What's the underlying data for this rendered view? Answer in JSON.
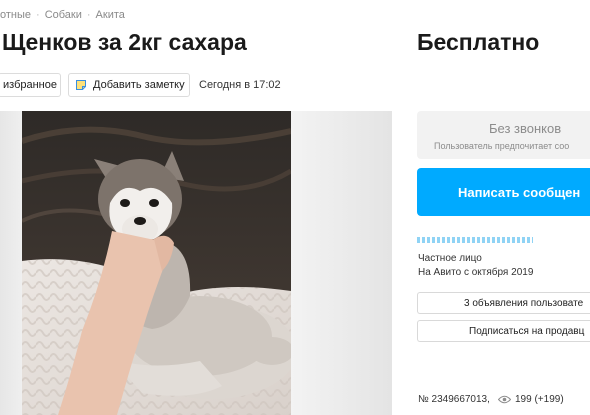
{
  "breadcrumb": [
    "отные",
    "Собаки",
    "Акита"
  ],
  "listing": {
    "title": "Щенков за 2кг сахара",
    "price": "Бесплатно",
    "date": "Сегодня в 17:02"
  },
  "actions": {
    "favorite_label": "избранное",
    "note_label": "Добавить заметку"
  },
  "contact": {
    "no_calls_title": "Без звонков",
    "no_calls_subtitle": "Пользователь предпочитает соо",
    "write_button": "Написать сообщен"
  },
  "seller": {
    "type": "Частное лицо",
    "since": "На Авито с октября 2019",
    "ads_button": "3 объявления пользовате",
    "subscribe_button": "Подписаться на продавц"
  },
  "footer": {
    "ad_number": "№ 2349667013,",
    "views": "199 (+199)"
  },
  "icons": {
    "note": "note-icon",
    "views": "eye-icon"
  },
  "colors": {
    "accent": "#00aaff",
    "panel": "#f2f2f2"
  }
}
